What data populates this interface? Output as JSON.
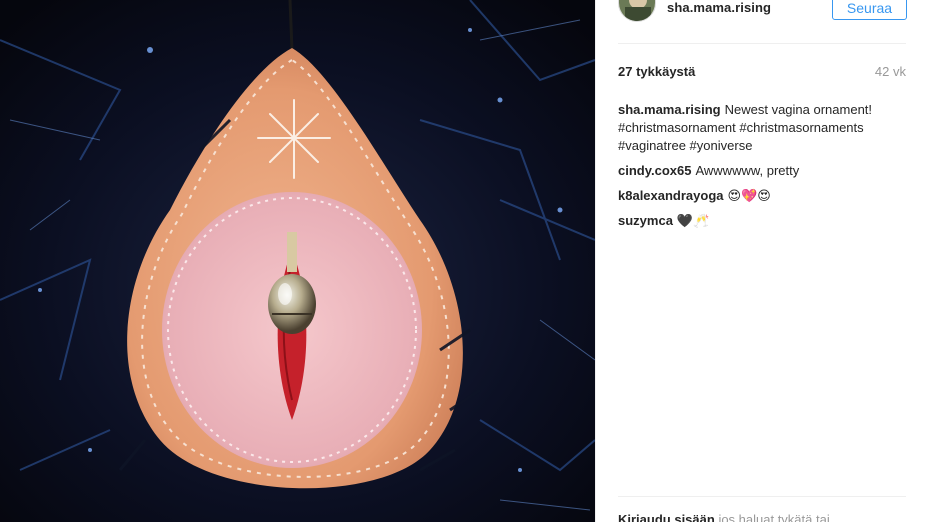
{
  "post": {
    "image_alt": "felt ornament photo"
  },
  "header": {
    "username": "sha.mama.rising",
    "follow_label": "Seuraa"
  },
  "stats": {
    "likes": "27 tykkäystä",
    "age": "42 vk"
  },
  "caption": {
    "author": "sha.mama.rising",
    "text": "Newest vagina ornament!",
    "tags_line1": "#christmasornament #christmasornaments",
    "tags_line2": "#vaginatree #yoniverse"
  },
  "comments": [
    {
      "author": "cindy.cox65",
      "text": "Awwwwww, pretty"
    },
    {
      "author": "k8alexandrayoga",
      "text": "😍💖😍"
    },
    {
      "author": "suzymca",
      "text": "🖤🥂"
    }
  ],
  "footer": {
    "login_label": "Kirjaudu sisään",
    "rest": "jos haluat tykätä tai"
  },
  "colors": {
    "link_blue": "#3897f0",
    "muted_gray": "#999999",
    "text": "#262626"
  }
}
